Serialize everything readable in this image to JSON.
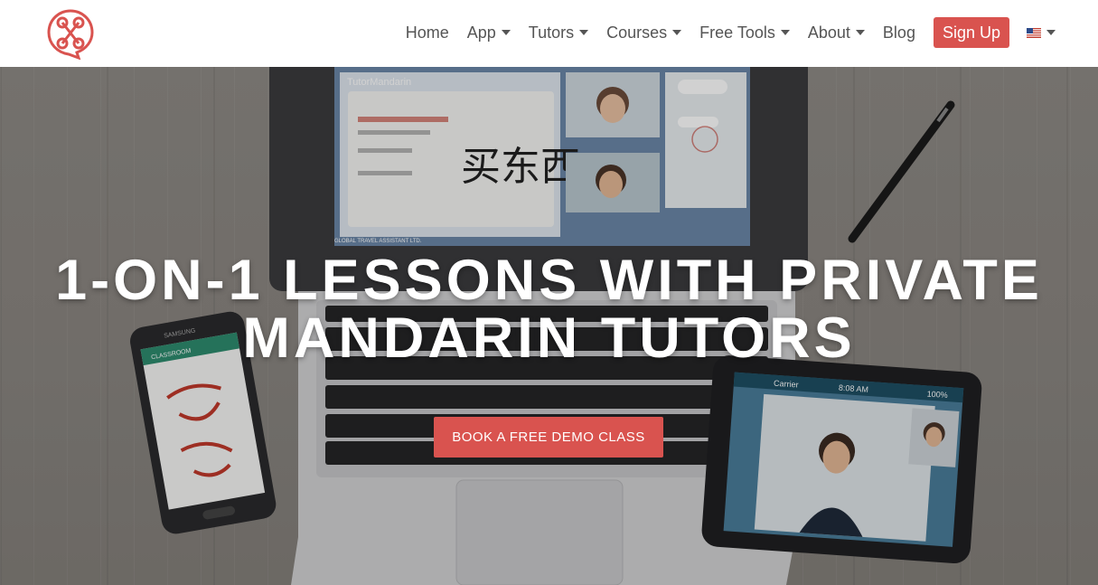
{
  "header": {
    "logo_name": "tutormandarin-logo",
    "nav": [
      {
        "label": "Home",
        "dropdown": false
      },
      {
        "label": "App",
        "dropdown": true
      },
      {
        "label": "Tutors",
        "dropdown": true
      },
      {
        "label": "Courses",
        "dropdown": true
      },
      {
        "label": "Free Tools",
        "dropdown": true
      },
      {
        "label": "About",
        "dropdown": true
      },
      {
        "label": "Blog",
        "dropdown": false
      }
    ],
    "signup_label": "Sign Up",
    "language_flag": "us-flag-icon"
  },
  "hero": {
    "headline_line1": "1-on-1 Lessons with Private",
    "headline_line2": "Mandarin Tutors",
    "cta_label": "Book a free demo class",
    "screen_app_name": "TutorMandarin",
    "screen_question": "买东西",
    "phone_brand": "SAMSUNG",
    "phone_app": "CLASSROOM",
    "tablet_carrier": "Carrier",
    "tablet_time": "8:08 AM",
    "tablet_battery": "100%",
    "laptop_footer": "GLOBAL TRAVEL ASSISTANT LTD."
  },
  "colors": {
    "brand": "#d9534f",
    "nav_text": "#555555",
    "hero_text": "#ffffff"
  }
}
